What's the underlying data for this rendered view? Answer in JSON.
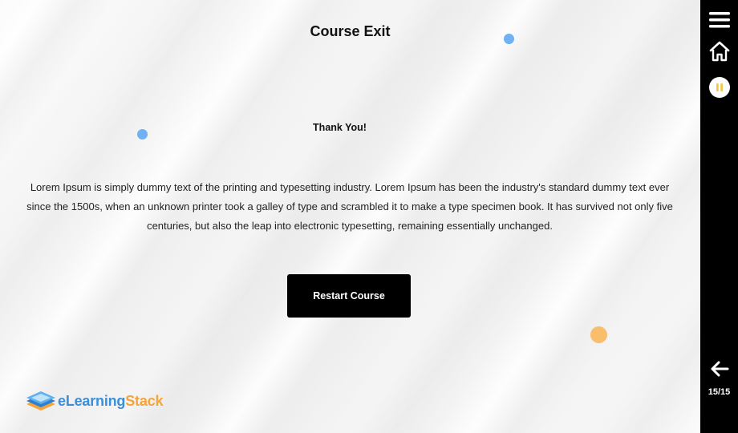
{
  "page": {
    "title": "Course Exit",
    "subtitle": "Thank You!",
    "body": "Lorem Ipsum is simply dummy text of the printing and typesetting industry. Lorem Ipsum has been the industry's standard dummy text ever since the 1500s, when an unknown printer took a galley of type and scrambled it to make a type specimen book. It has survived not only five centuries, but also the leap into electronic typesetting, remaining essentially unchanged.",
    "restart_label": "Restart Course"
  },
  "logo": {
    "part_e": "e",
    "part_learning": "Learning",
    "part_stack": "Stack"
  },
  "sidebar": {
    "icons": [
      "menu-icon",
      "home-icon",
      "pause-icon",
      "arrow-left-icon"
    ],
    "page_counter": "15/15"
  },
  "colors": {
    "accent_blue": "#6fb1f2",
    "accent_orange": "#f9be6b",
    "pause_yellow": "#f5c84a",
    "sidebar_bg": "#000000",
    "button_bg": "#000000"
  }
}
